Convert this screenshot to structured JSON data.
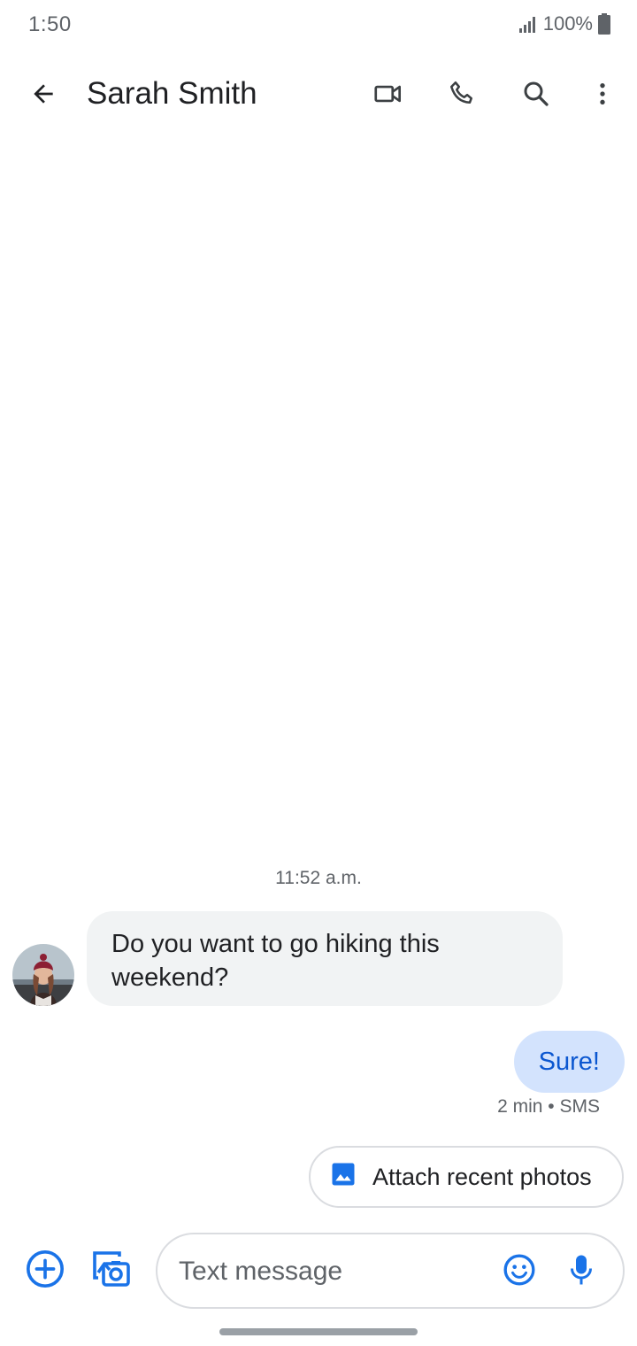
{
  "status_bar": {
    "time": "1:50",
    "battery": "100%",
    "icons": [
      "signal-icon",
      "battery-icon"
    ]
  },
  "header": {
    "contact_name": "Sarah Smith",
    "icons": [
      "back-arrow-icon",
      "video-call-icon",
      "phone-icon",
      "search-icon",
      "more-vert-icon"
    ]
  },
  "conversation": {
    "timestamp": "11:52 a.m.",
    "incoming_message": "Do you want to go hiking this weekend?",
    "outgoing_message": "Sure!",
    "outgoing_meta": "2 min • SMS"
  },
  "suggestion": {
    "label": "Attach recent photos",
    "icon": "image-icon"
  },
  "compose": {
    "placeholder": "Text message",
    "value": "",
    "icons": [
      "add-circle-icon",
      "gallery-camera-icon",
      "emoji-icon",
      "mic-icon"
    ]
  },
  "colors": {
    "accent": "#1a73e8",
    "incoming_bubble": "#f1f3f4",
    "outgoing_bubble": "#d3e3fd",
    "outgoing_text": "#0b57d0",
    "secondary_text": "#5f6368"
  }
}
